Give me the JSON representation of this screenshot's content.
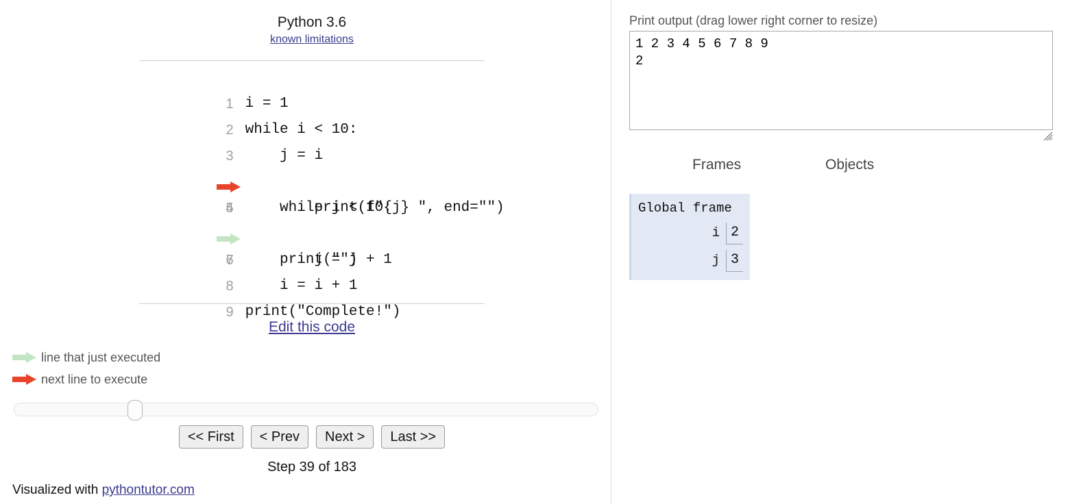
{
  "code_panel": {
    "python_version": "Python 3.6",
    "known_limitations_link": "known limitations",
    "edit_code_link": "Edit this code",
    "lines": [
      {
        "number": "1",
        "text": "i = 1",
        "arrow": "none"
      },
      {
        "number": "2",
        "text": "while i < 10:",
        "arrow": "none"
      },
      {
        "number": "3",
        "text": "    j = i",
        "arrow": "none"
      },
      {
        "number": "4",
        "text": "    while j < 10:",
        "arrow": "red"
      },
      {
        "number": "5",
        "text": "        print(f\"{j} \", end=\"\")",
        "arrow": "none"
      },
      {
        "number": "6",
        "text": "        j = j + 1",
        "arrow": "green"
      },
      {
        "number": "7",
        "text": "    print(\"\")",
        "arrow": "none"
      },
      {
        "number": "8",
        "text": "    i = i + 1",
        "arrow": "none"
      },
      {
        "number": "9",
        "text": "print(\"Complete!\")",
        "arrow": "none"
      }
    ]
  },
  "legend": {
    "just_executed": "line that just executed",
    "next_to_execute": "next line to execute",
    "green_color": "#c3e5c3",
    "red_color": "#e8442c"
  },
  "controls": {
    "first_label": "<< First",
    "prev_label": "< Prev",
    "next_label": "Next >",
    "last_label": "Last >>",
    "step_counter": "Step 39 of 183",
    "step_current": 39,
    "step_total": 183
  },
  "footer": {
    "prefix": "Visualized with ",
    "link": "pythontutor.com"
  },
  "output_panel": {
    "label": "Print output (drag lower right corner to resize)",
    "text": "1 2 3 4 5 6 7 8 9\n2"
  },
  "visualization": {
    "frames_heading": "Frames",
    "objects_heading": "Objects",
    "global_frame": {
      "title": "Global frame",
      "background_color": "#e2e8f4",
      "variables": [
        {
          "name": "i",
          "value": "2"
        },
        {
          "name": "j",
          "value": "3"
        }
      ]
    },
    "objects": []
  }
}
